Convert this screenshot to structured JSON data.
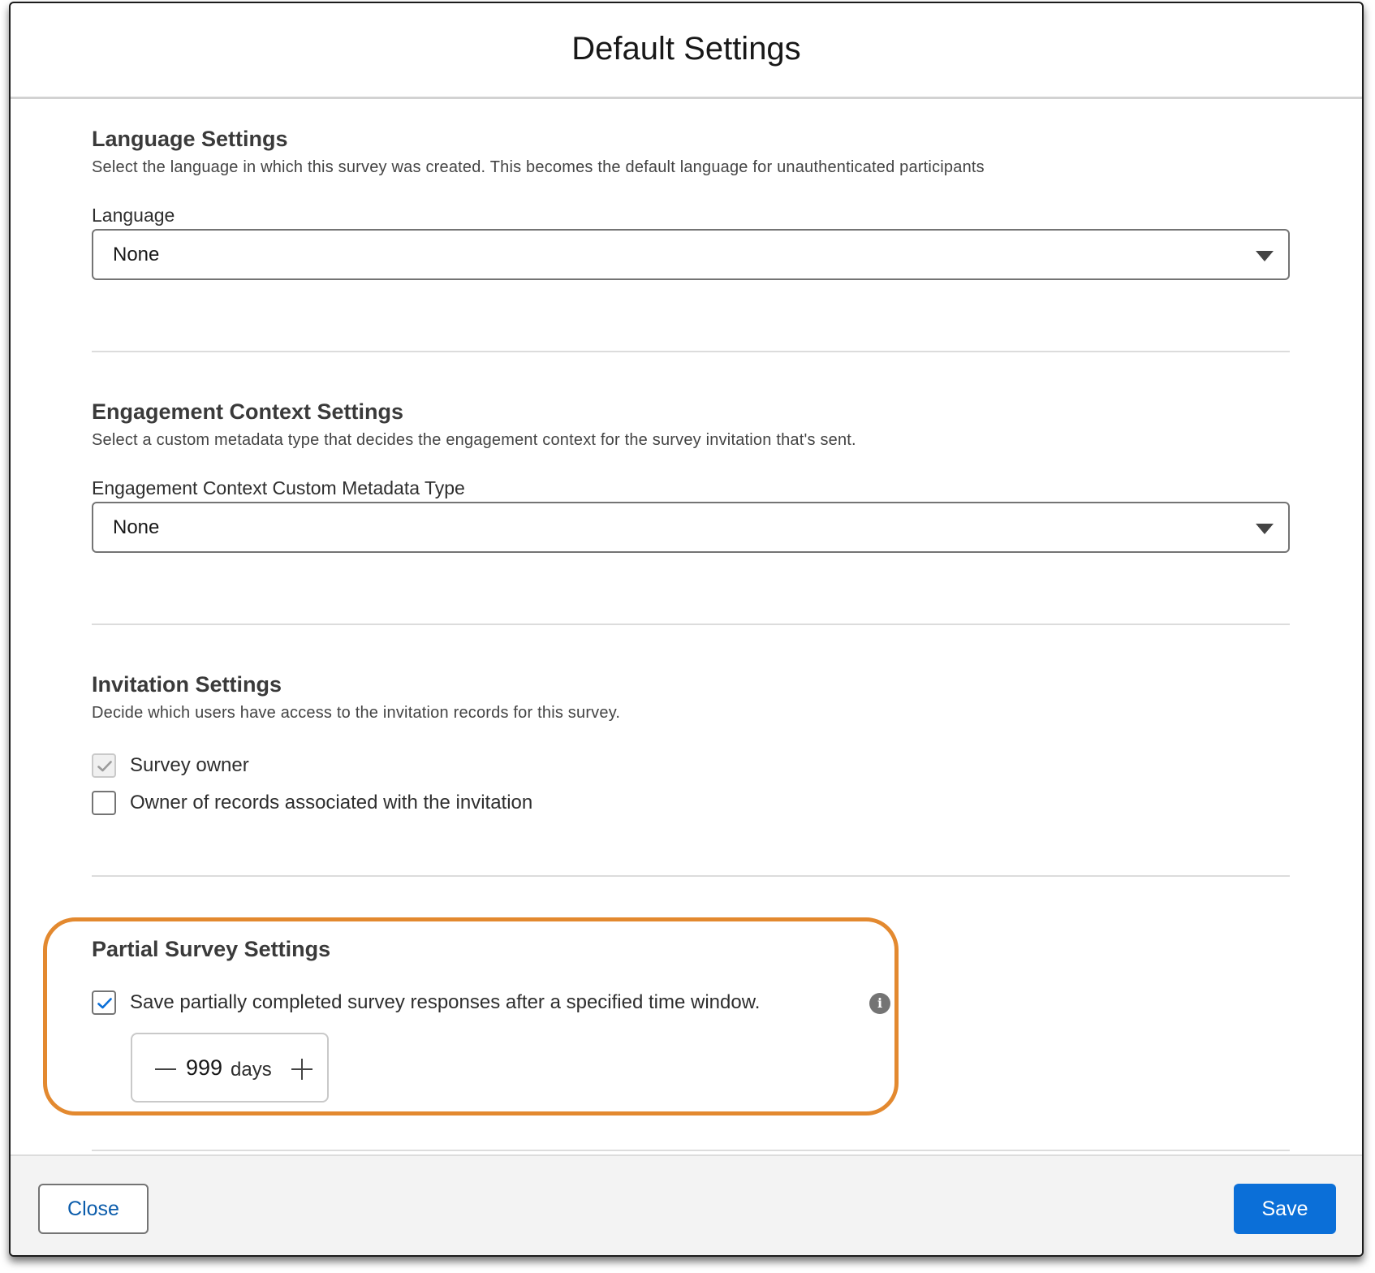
{
  "modal": {
    "title": "Default Settings"
  },
  "language_settings": {
    "title": "Language Settings",
    "description": "Select the language in which this survey was created. This becomes the default language for unauthenticated participants",
    "field_label": "Language",
    "selected_value": "None"
  },
  "engagement_settings": {
    "title": "Engagement Context Settings",
    "description": "Select a custom metadata type that decides the engagement context for the survey invitation that's sent.",
    "field_label": "Engagement Context Custom Metadata Type",
    "selected_value": "None"
  },
  "invitation_settings": {
    "title": "Invitation Settings",
    "description": "Decide which users have access to the invitation records for this survey.",
    "options": [
      {
        "label": "Survey owner",
        "checked": true,
        "disabled": true
      },
      {
        "label": "Owner of records associated with the invitation",
        "checked": false,
        "disabled": false
      }
    ]
  },
  "partial_survey_settings": {
    "title": "Partial Survey Settings",
    "save_partial_label": "Save partially completed survey responses after a specified time window.",
    "save_partial_checked": true,
    "time_window_value": "999",
    "time_window_unit": "days"
  },
  "footer": {
    "close_label": "Close",
    "save_label": "Save"
  },
  "colors": {
    "accent": "#0b6fd8",
    "highlight": "#e3892f",
    "checkmark": "#0b6fd8",
    "checkmark_disabled": "#9b9b9b"
  },
  "icons": {
    "select_arrow": "chevron-down-icon",
    "info": "info-icon",
    "check": "check-icon",
    "minus": "minus-icon",
    "plus": "plus-icon"
  }
}
